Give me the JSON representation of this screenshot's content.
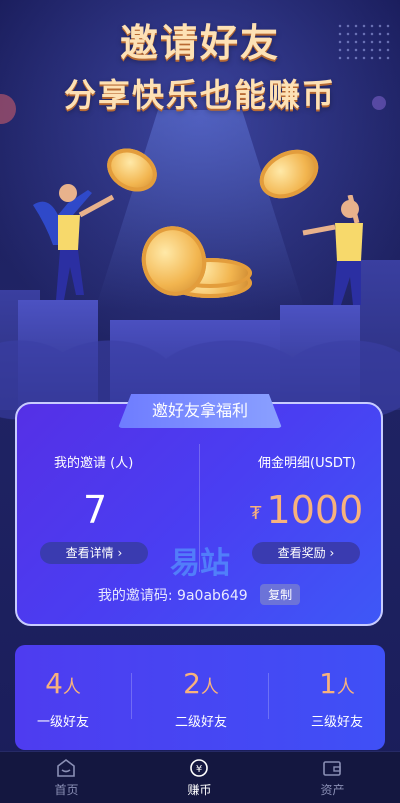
{
  "hero": {
    "title_line1": "邀请好友",
    "title_line2": "分享快乐也能赚币"
  },
  "invite_panel": {
    "tab_label": "邀好友拿福利",
    "my_invites_label": "我的邀请 (人)",
    "my_invites_count": "7",
    "view_details_label": "查看详情",
    "commission_label": "佣金明细(USDT)",
    "commission_symbol": "₮",
    "commission_amount": "1000",
    "view_rewards_label": "查看奖励",
    "invite_code_label": "我的邀请码: 9a0ab649",
    "copy_label": "复制",
    "watermark": "易站"
  },
  "levels": [
    {
      "count": "4",
      "unit": "人",
      "name": "一级好友"
    },
    {
      "count": "2",
      "unit": "人",
      "name": "二级好友"
    },
    {
      "count": "1",
      "unit": "人",
      "name": "三级好友"
    }
  ],
  "tabbar": {
    "items": [
      {
        "label": "首页",
        "icon": "home-icon",
        "active": false
      },
      {
        "label": "赚币",
        "icon": "earn-coin-icon",
        "active": true
      },
      {
        "label": "资产",
        "icon": "wallet-icon",
        "active": false
      }
    ]
  },
  "colors": {
    "accent_orange": "#f7b27d",
    "panel_blue": "#4a3ef2",
    "background": "#1b1f5e"
  }
}
